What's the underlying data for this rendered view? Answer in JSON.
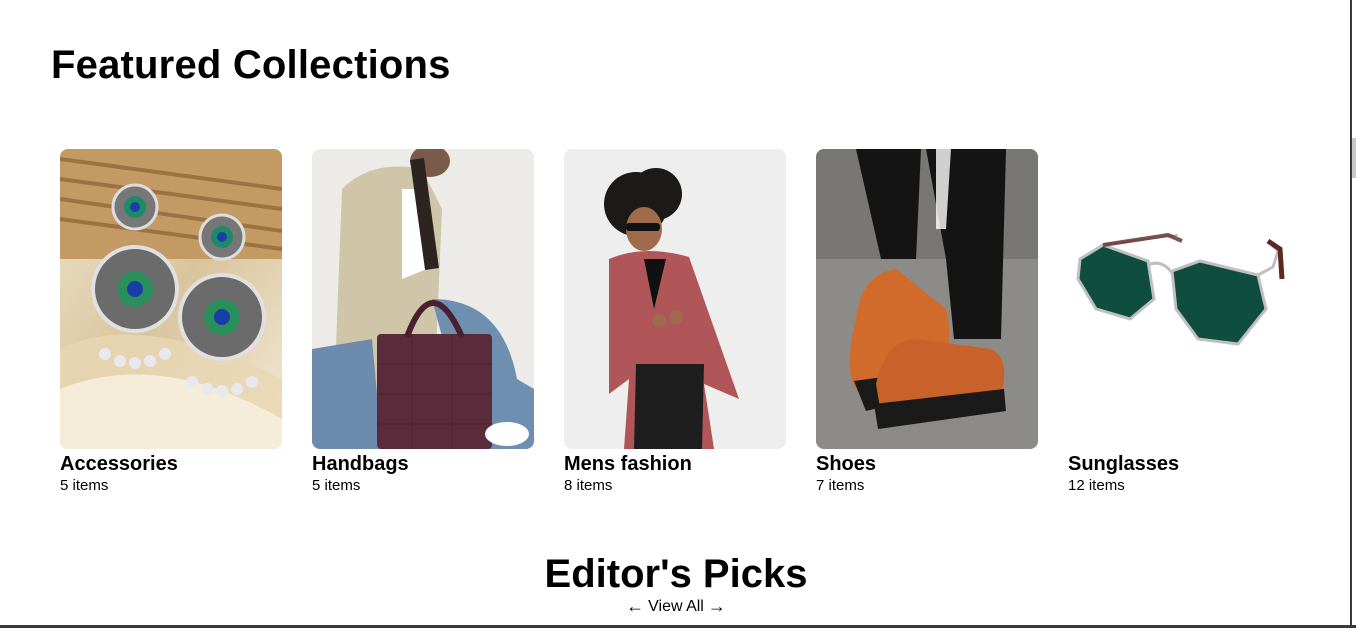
{
  "featured": {
    "title": "Featured Collections",
    "collections": [
      {
        "name": "Accessories",
        "count": "5 items",
        "image_icon": "earrings-image"
      },
      {
        "name": "Handbags",
        "count": "5 items",
        "image_icon": "handbag-model-image"
      },
      {
        "name": "Mens fashion",
        "count": "8 items",
        "image_icon": "mens-blazer-image"
      },
      {
        "name": "Shoes",
        "count": "7 items",
        "image_icon": "orange-sneakers-image"
      },
      {
        "name": "Sunglasses",
        "count": "12 items",
        "image_icon": "sunglasses-image"
      }
    ]
  },
  "editors": {
    "title": "Editor's Picks",
    "prev_arrow": "←",
    "view_all_label": "View All",
    "next_arrow": "→"
  }
}
